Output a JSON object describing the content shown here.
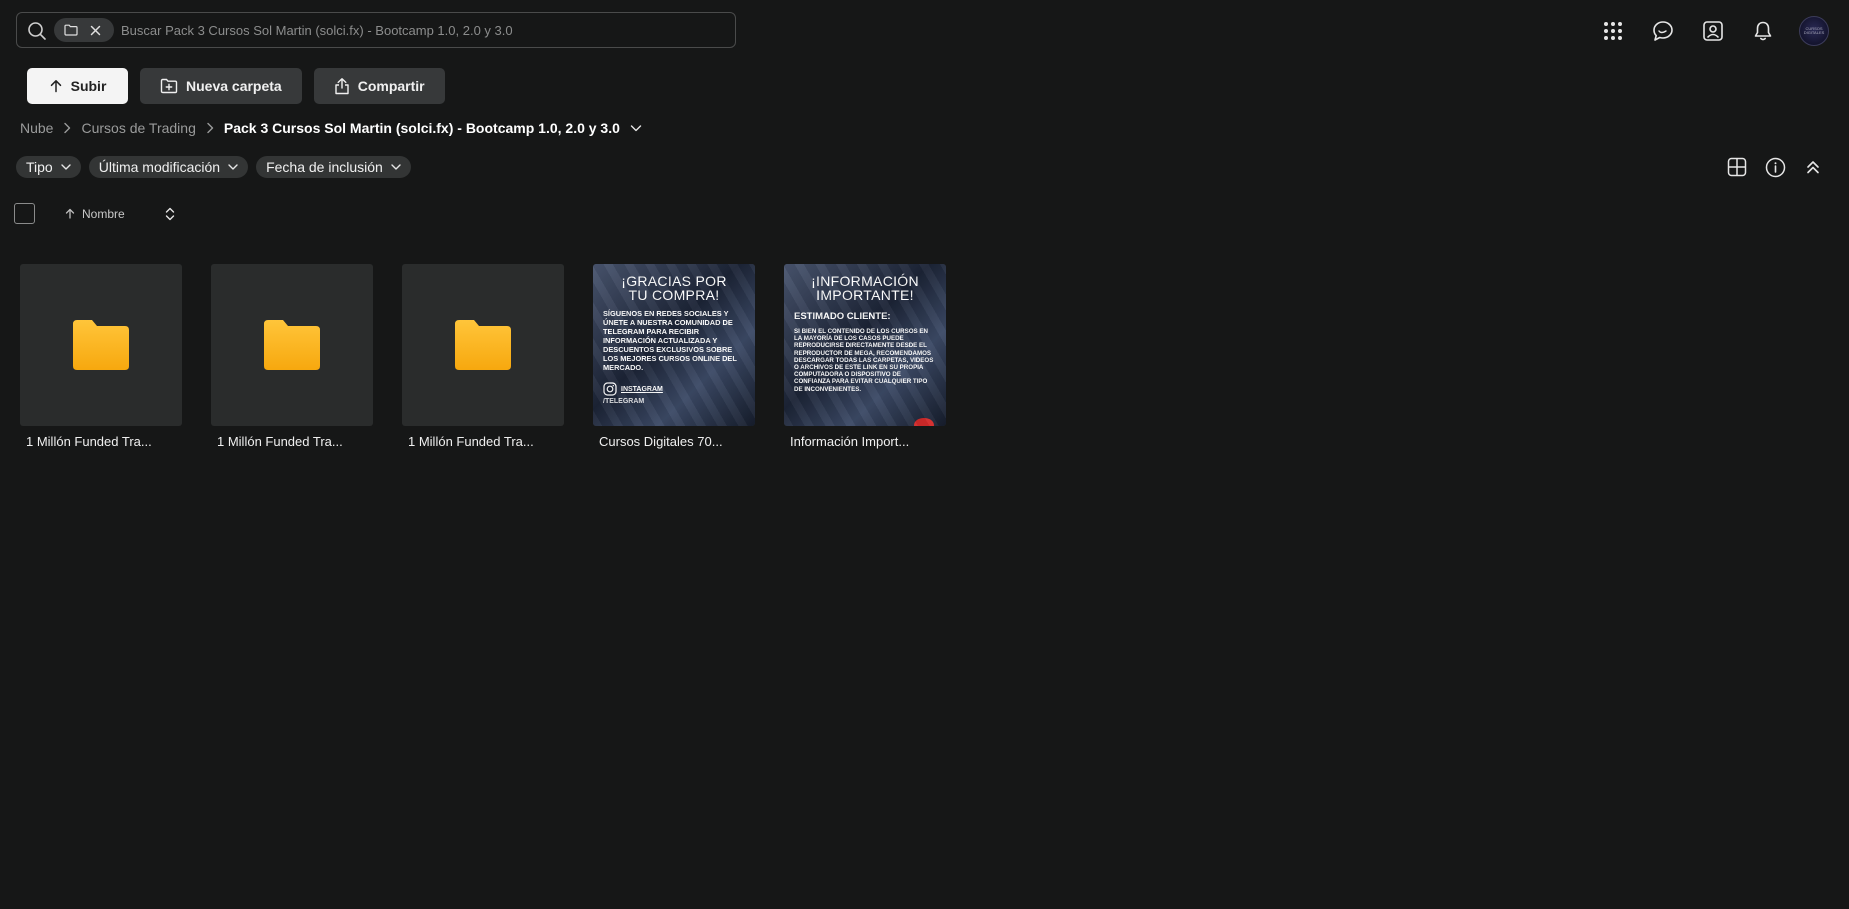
{
  "search": {
    "placeholder": "Buscar Pack 3 Cursos Sol Martin (solci.fx) - Bootcamp 1.0, 2.0 y 3.0",
    "value": ""
  },
  "header_icons": [
    "apps-grid-icon",
    "chat-icon",
    "contacts-icon",
    "notifications-bell-icon"
  ],
  "avatar": {
    "text": "CURSOS DIGITALES"
  },
  "actions": {
    "upload_label": "Subir",
    "new_folder_label": "Nueva carpeta",
    "share_label": "Compartir"
  },
  "breadcrumb": [
    {
      "label": "Nube"
    },
    {
      "label": "Cursos de Trading"
    },
    {
      "label": "Pack 3 Cursos Sol Martin (solci.fx) - Bootcamp 1.0, 2.0 y 3.0"
    }
  ],
  "filters": [
    {
      "label": "Tipo"
    },
    {
      "label": "Última modificación"
    },
    {
      "label": "Fecha de inclusión"
    }
  ],
  "sort": {
    "label": "Nombre",
    "direction": "ascending"
  },
  "items": [
    {
      "type": "folder",
      "name": "1 Millón Funded Tra..."
    },
    {
      "type": "folder",
      "name": "1 Millón Funded Tra..."
    },
    {
      "type": "folder",
      "name": "1 Millón Funded Tra..."
    },
    {
      "type": "image",
      "name": "Cursos Digitales 70..."
    },
    {
      "type": "image",
      "name": "Información Import..."
    }
  ],
  "poster1": {
    "title_line1": "¡GRACIAS POR",
    "title_line2": "TU COMPRA!",
    "body": "SÍGUENOS EN REDES SOCIALES Y ÚNETE A NUESTRA COMUNIDAD DE TELEGRAM PARA RECIBIR INFORMACIÓN ACTUALIZADA Y DESCUENTOS EXCLUSIVOS SOBRE LOS MEJORES CURSOS ONLINE DEL MERCADO.",
    "instagram": "INSTAGRAM",
    "cut": "/TELEGRAM"
  },
  "poster2": {
    "title_line1": "¡INFORMACIÓN",
    "title_line2": "IMPORTANTE!",
    "heading": "ESTIMADO CLIENTE:",
    "body": "SI BIEN EL CONTENIDO DE LOS CURSOS EN LA MAYORÍA DE LOS CASOS PUEDE REPRODUCIRSE DIRECTAMENTE DESDE EL REPRODUCTOR DE MEGA, RECOMENDAMOS DESCARGAR TODAS LAS CARPETAS, VIDEOS O ARCHIVOS DE ESTE LINK EN SU PROPIA COMPUTADORA O DISPOSITIVO DE CONFIANZA PARA EVITAR CUALQUIER TIPO DE INCONVENIENTES."
  },
  "colors": {
    "background": "#161717",
    "folder_yellow": "#fbb81f",
    "card": "#2a2c2c",
    "chip": "#37393a"
  }
}
